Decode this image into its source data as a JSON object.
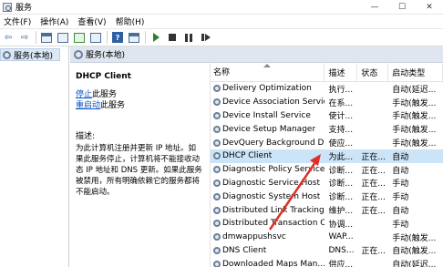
{
  "window": {
    "title": "服务",
    "controls": [
      "—",
      "☐",
      "✕"
    ]
  },
  "menu": [
    {
      "label": "文件(F)"
    },
    {
      "label": "操作(A)"
    },
    {
      "label": "查看(V)"
    },
    {
      "label": "帮助(H)"
    }
  ],
  "tree": {
    "root_label": "服务(本地)"
  },
  "header": {
    "title": "服务(本地)"
  },
  "detail": {
    "service_name": "DHCP Client",
    "stop_link": "停止",
    "stop_suffix": "此服务",
    "restart_link": "重启动",
    "restart_suffix": "此服务",
    "description_label": "描述:",
    "description": "为此计算机注册并更新 IP 地址。如果此服务停止，计算机将不能接收动态 IP 地址和 DNS 更新。如果此服务被禁用，所有明确依赖它的服务都将不能启动。"
  },
  "columns": {
    "name": "名称",
    "desc": "描述",
    "status": "状态",
    "type": "启动类型"
  },
  "rows": [
    {
      "name": "Delivery Optimization",
      "desc": "执行...",
      "status": "",
      "type": "自动(延迟..."
    },
    {
      "name": "Device Association Service",
      "desc": "在系...",
      "status": "",
      "type": "手动(触发..."
    },
    {
      "name": "Device Install Service",
      "desc": "使计...",
      "status": "",
      "type": "手动(触发..."
    },
    {
      "name": "Device Setup Manager",
      "desc": "支持...",
      "status": "",
      "type": "手动(触发..."
    },
    {
      "name": "DevQuery Background D...",
      "desc": "使应...",
      "status": "",
      "type": "手动(触发..."
    },
    {
      "name": "DHCP Client",
      "desc": "为此...",
      "status": "正在...",
      "type": "自动"
    },
    {
      "name": "Diagnostic Policy Service",
      "desc": "诊断...",
      "status": "正在...",
      "type": "自动"
    },
    {
      "name": "Diagnostic Service Host",
      "desc": "诊断...",
      "status": "正在...",
      "type": "手动"
    },
    {
      "name": "Diagnostic System Host",
      "desc": "诊断...",
      "status": "正在...",
      "type": "手动"
    },
    {
      "name": "Distributed Link Tracking...",
      "desc": "维护...",
      "status": "正在...",
      "type": "自动"
    },
    {
      "name": "Distributed Transaction C...",
      "desc": "协调...",
      "status": "",
      "type": "手动"
    },
    {
      "name": "dmwappushsvc",
      "desc": "WAP...",
      "status": "",
      "type": "手动(触发..."
    },
    {
      "name": "DNS Client",
      "desc": "DNS...",
      "status": "正在...",
      "type": "自动(触发..."
    },
    {
      "name": "Downloaded Maps Man...",
      "desc": "供应...",
      "status": "",
      "type": "自动(延迟..."
    }
  ],
  "selected_row": "DHCP Client",
  "colors": {
    "selection": "#cce4f7",
    "header_bg": "#dfe6ef",
    "link": "#0b55c4",
    "annotation_arrow": "#e0302a"
  }
}
